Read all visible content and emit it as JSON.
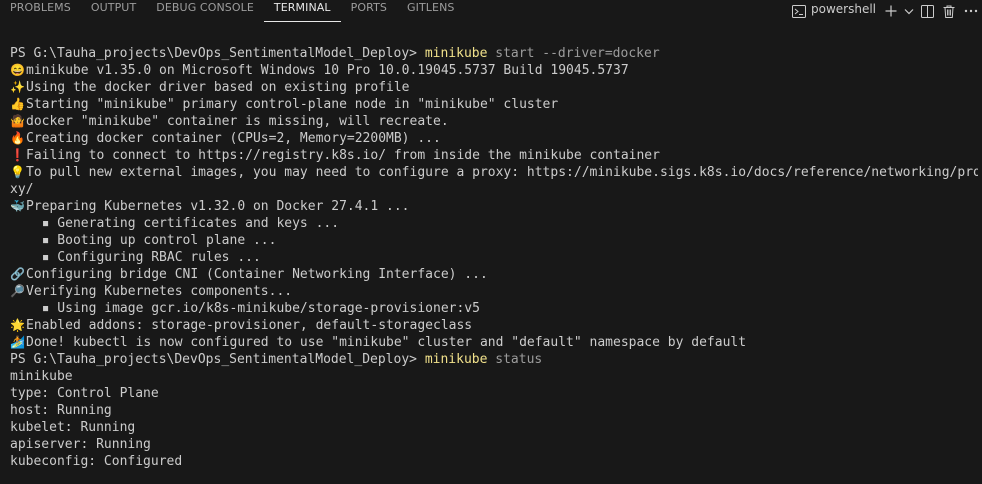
{
  "tabs": [
    {
      "label": "PROBLEMS"
    },
    {
      "label": "OUTPUT"
    },
    {
      "label": "DEBUG CONSOLE"
    },
    {
      "label": "TERMINAL",
      "active": true
    },
    {
      "label": "PORTS"
    },
    {
      "label": "GITLENS"
    }
  ],
  "toolbar": {
    "shell_label": "powershell",
    "icons": [
      "terminal-icon",
      "add-icon",
      "chevron-down-icon",
      "split-icon",
      "trash-icon",
      "more-icon"
    ]
  },
  "terminal": {
    "prompt1": "PS G:\\Tauha_projects\\DevOps_SentimentalModel_Deploy> ",
    "cmd1": "minikube",
    "args1": " start --driver=docker",
    "lines": [
      {
        "icon": "😄",
        "text": "minikube v1.35.0 on Microsoft Windows 10 Pro 10.0.19045.5737 Build 19045.5737"
      },
      {
        "icon": "✨",
        "text": "Using the docker driver based on existing profile"
      },
      {
        "icon": "👍",
        "text": "Starting \"minikube\" primary control-plane node in \"minikube\" cluster"
      },
      {
        "icon": "🤷",
        "text": "docker \"minikube\" container is missing, will recreate."
      },
      {
        "icon": "🔥",
        "text": "Creating docker container (CPUs=2, Memory=2200MB) ..."
      },
      {
        "icon": "❗",
        "text": "Failing to connect to https://registry.k8s.io/ from inside the minikube container"
      },
      {
        "icon": "💡",
        "text": "To pull new external images, you may need to configure a proxy: https://minikube.sigs.k8s.io/docs/reference/networking/pro"
      },
      {
        "icon": "",
        "text": "xy/"
      },
      {
        "icon": "🐳",
        "text": "Preparing Kubernetes v1.32.0 on Docker 27.4.1 ..."
      },
      {
        "icon": "",
        "text": "  ▪ Generating certificates and keys ..."
      },
      {
        "icon": "",
        "text": "  ▪ Booting up control plane ..."
      },
      {
        "icon": "",
        "text": "  ▪ Configuring RBAC rules ..."
      },
      {
        "icon": "🔗",
        "text": "Configuring bridge CNI (Container Networking Interface) ..."
      },
      {
        "icon": "🔎",
        "text": "Verifying Kubernetes components..."
      },
      {
        "icon": "",
        "text": "  ▪ Using image gcr.io/k8s-minikube/storage-provisioner:v5"
      },
      {
        "icon": "🌟",
        "text": "Enabled addons: storage-provisioner, default-storageclass"
      },
      {
        "icon": "🏄",
        "text": "Done! kubectl is now configured to use \"minikube\" cluster and \"default\" namespace by default"
      }
    ],
    "prompt2": "PS G:\\Tauha_projects\\DevOps_SentimentalModel_Deploy> ",
    "cmd2": "minikube",
    "args2": " status",
    "status": [
      "minikube",
      "type: Control Plane",
      "host: Running",
      "kubelet: Running",
      "apiserver: Running",
      "kubeconfig: Configured"
    ]
  }
}
